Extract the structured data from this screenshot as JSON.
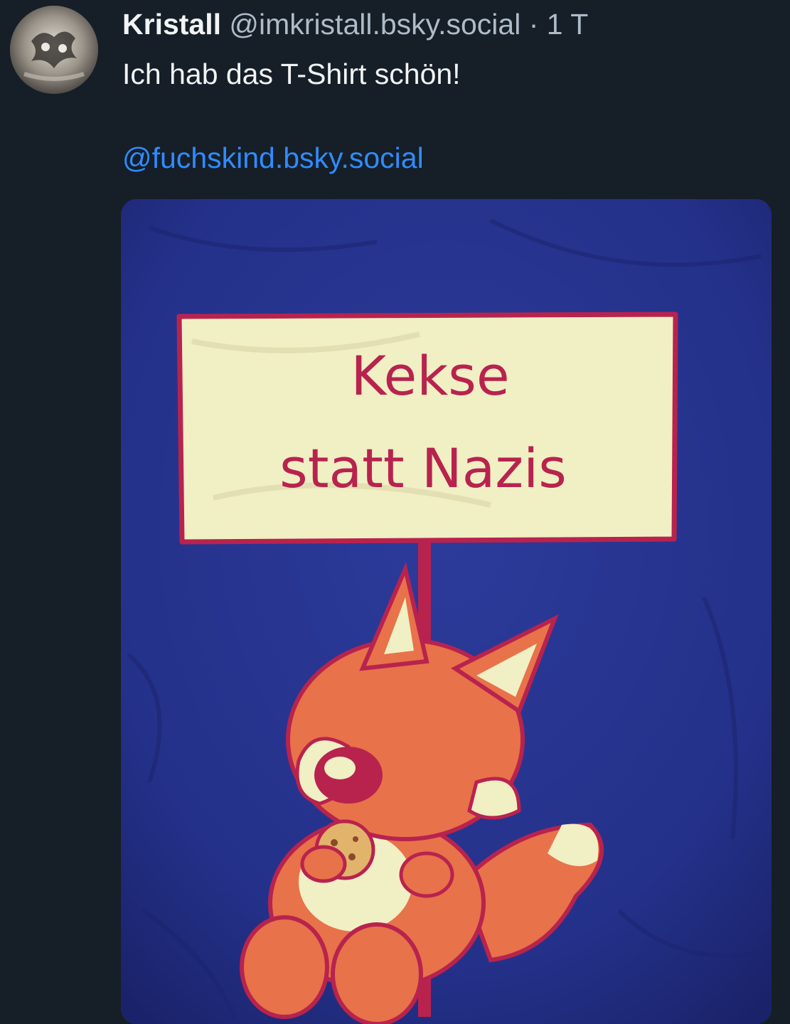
{
  "post": {
    "author": {
      "display_name": "Kristall",
      "handle": "@imkristall.bsky.social"
    },
    "separator": "·",
    "age": "1 T",
    "text": "Ich hab das T-Shirt schön!",
    "mention": "@fuchskind.bsky.social",
    "image": {
      "sign_line_1": "Kekse",
      "sign_line_2": "statt Nazis",
      "shirt_color": "#25338a",
      "sign_color": "#f1efc4",
      "print_color": "#b8234e",
      "fox_color": "#e8724a"
    }
  },
  "colors": {
    "background": "#161e27",
    "handle_text": "#aebbc9",
    "link": "#2f8cff"
  }
}
